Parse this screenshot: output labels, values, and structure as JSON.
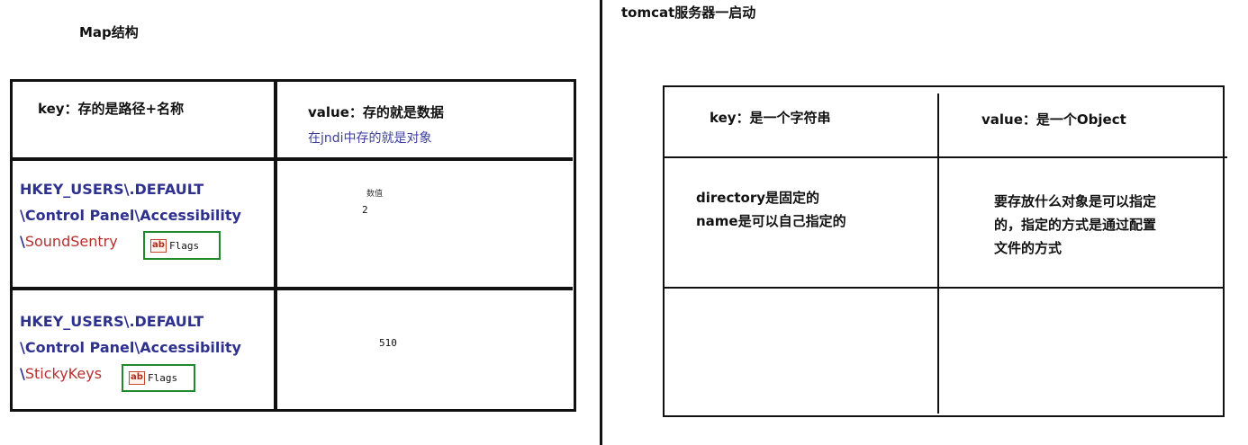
{
  "left": {
    "title": "Map结构",
    "header_key": "key：存的是路径+名称",
    "header_value": "value：存的就是数据",
    "header_value_sub": "在jndi中存的就是对象",
    "rows": [
      {
        "path_line1": "HKEY_USERS\\.DEFAULT",
        "path_line2": "\\Control Panel\\Accessibility",
        "path_line3_prefix": "\\",
        "path_line3_red": "SoundSentry",
        "flag_icon": "ab",
        "flag_label": "Flags",
        "value_caption": "数值",
        "value": "2"
      },
      {
        "path_line1": "HKEY_USERS\\.DEFAULT",
        "path_line2": "\\Control Panel\\Accessibility",
        "path_line3_prefix": "\\",
        "path_line3_red": "StickyKeys",
        "flag_icon": "ab",
        "flag_label": "Flags",
        "value": "510"
      }
    ]
  },
  "right": {
    "title": "tomcat服务器一启动",
    "header_key": "key：是一个字符串",
    "header_value": "value：是一个Object",
    "row1_key_line1": "directory是固定的",
    "row1_key_line2": "name是可以自己指定的",
    "row1_value_line1": "要存放什么对象是可以指定",
    "row1_value_line2": "的，指定的方式是通过配置",
    "row1_value_line3": "文件的方式"
  },
  "colors": {
    "path_blue": "#2e318d",
    "path_red": "#b6302e",
    "flag_border": "#1f8a2c",
    "sub_blue": "#3b3e9c"
  }
}
